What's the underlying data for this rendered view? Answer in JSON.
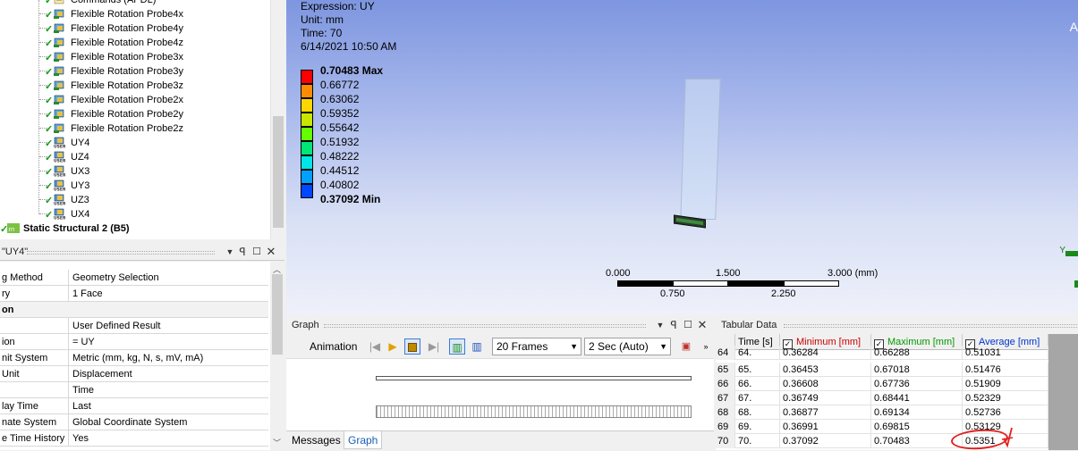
{
  "tree": {
    "items": [
      {
        "label": "Commands (APDL)",
        "icon": "apdl-commands-icon"
      },
      {
        "label": "Flexible Rotation Probe4x",
        "icon": "probe-icon"
      },
      {
        "label": "Flexible Rotation Probe4y",
        "icon": "probe-icon"
      },
      {
        "label": "Flexible Rotation Probe4z",
        "icon": "probe-icon"
      },
      {
        "label": "Flexible Rotation Probe3x",
        "icon": "probe-icon"
      },
      {
        "label": "Flexible Rotation Probe3y",
        "icon": "probe-icon"
      },
      {
        "label": "Flexible Rotation Probe3z",
        "icon": "probe-icon"
      },
      {
        "label": "Flexible Rotation Probe2x",
        "icon": "probe-icon"
      },
      {
        "label": "Flexible Rotation Probe2y",
        "icon": "probe-icon"
      },
      {
        "label": "Flexible Rotation Probe2z",
        "icon": "probe-icon"
      },
      {
        "label": "UY4",
        "icon": "user-result-icon",
        "selected": true
      },
      {
        "label": "UZ4",
        "icon": "user-result-icon"
      },
      {
        "label": "UX3",
        "icon": "user-result-icon"
      },
      {
        "label": "UY3",
        "icon": "user-result-icon"
      },
      {
        "label": "UZ3",
        "icon": "user-result-icon"
      },
      {
        "label": "UX4",
        "icon": "user-result-icon"
      }
    ],
    "system": {
      "label": "Static Structural 2 (B5)",
      "icon": "static-structural-icon"
    }
  },
  "details": {
    "title": "\"UY4\"",
    "rows": [
      {
        "k": "g Method",
        "v": "Geometry Selection"
      },
      {
        "k": "ry",
        "v": "1 Face"
      },
      {
        "k": "on",
        "v": "",
        "section": true
      },
      {
        "k": "",
        "v": "User Defined Result"
      },
      {
        "k": "ion",
        "v": "= UY"
      },
      {
        "k": "nit System",
        "v": "Metric (mm, kg, N, s, mV, mA)"
      },
      {
        "k": "Unit",
        "v": "Displacement"
      },
      {
        "k": "",
        "v": "Time"
      },
      {
        "k": "lay Time",
        "v": "Last"
      },
      {
        "k": "nate System",
        "v": "Global Coordinate System"
      },
      {
        "k": "e Time History",
        "v": "Yes"
      }
    ]
  },
  "viewport": {
    "info": [
      "Expression: UY",
      "Unit: mm",
      "Time: 70",
      "6/14/2021 10:50 AM"
    ],
    "corner": "A",
    "legend": {
      "max_label": "0.70483 Max",
      "min_label": "0.37092 Min",
      "ticks": [
        "0.66772",
        "0.63062",
        "0.59352",
        "0.55642",
        "0.51932",
        "0.48222",
        "0.44512",
        "0.40802"
      ],
      "colors": [
        "#ff0000",
        "#ff8c00",
        "#ffd700",
        "#c8e600",
        "#66ff00",
        "#00e676",
        "#00e5e5",
        "#00a0ff",
        "#0048ff"
      ]
    },
    "scale": {
      "labels_top": [
        "0.000",
        "1.500",
        "3.000 (mm)"
      ],
      "labels_bottom": [
        "0.750",
        "2.250"
      ]
    },
    "axis": "Y"
  },
  "graph": {
    "title": "Graph",
    "animation_label": "Animation",
    "frames": "20 Frames",
    "duration": "2 Sec (Auto)",
    "tabs": [
      "Messages",
      "Graph"
    ]
  },
  "tabular": {
    "title": "Tabular Data",
    "headers": [
      "Time [s]",
      "Minimum [mm]",
      "Maximum [mm]",
      "Average [mm]"
    ],
    "header_colors": [
      "#000000",
      "#cc0000",
      "#009900",
      "#0033cc"
    ],
    "rows": [
      [
        "64",
        "64.",
        "0.36284",
        "0.66288",
        "0.51031"
      ],
      [
        "65",
        "65.",
        "0.36453",
        "0.67018",
        "0.51476"
      ],
      [
        "66",
        "66.",
        "0.36608",
        "0.67736",
        "0.51909"
      ],
      [
        "67",
        "67.",
        "0.36749",
        "0.68441",
        "0.52329"
      ],
      [
        "68",
        "68.",
        "0.36877",
        "0.69134",
        "0.52736"
      ],
      [
        "69",
        "69.",
        "0.36991",
        "0.69815",
        "0.53129"
      ],
      [
        "70",
        "70.",
        "0.37092",
        "0.70483",
        "0.5351"
      ]
    ]
  }
}
